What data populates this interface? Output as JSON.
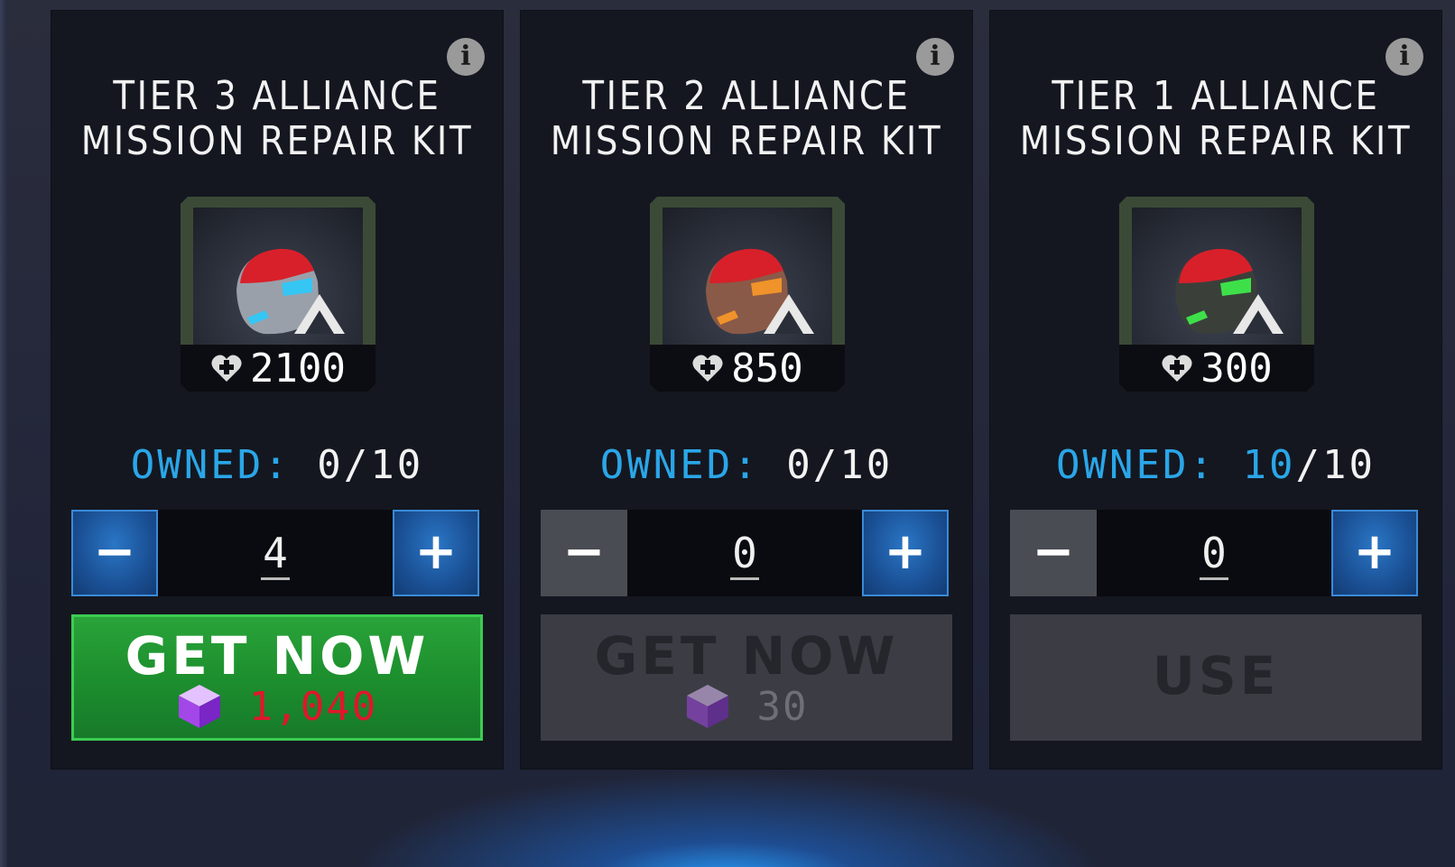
{
  "cards": [
    {
      "title_line1": "TIER 3 ALLIANCE",
      "title_line2": "MISSION REPAIR KIT",
      "heal_amount": "2100",
      "visor_color": "#35c6f4",
      "armor_color": "#9aa0aa",
      "owned_label": "OWNED:",
      "owned_count": "0",
      "owned_max": "/10",
      "quantity": "4",
      "minus_label": "−",
      "plus_label": "+",
      "action_label": "GET NOW",
      "price": "1,040",
      "icon": "info-icon"
    },
    {
      "title_line1": "TIER 2 ALLIANCE",
      "title_line2": "MISSION REPAIR KIT",
      "heal_amount": "850",
      "visor_color": "#f0932a",
      "armor_color": "#8a5a48",
      "owned_label": "OWNED:",
      "owned_count": "0",
      "owned_max": "/10",
      "quantity": "0",
      "minus_label": "−",
      "plus_label": "+",
      "action_label": "GET NOW",
      "price": "30",
      "icon": "info-icon"
    },
    {
      "title_line1": "TIER 1 ALLIANCE",
      "title_line2": "MISSION REPAIR KIT",
      "heal_amount": "300",
      "visor_color": "#3ee04a",
      "armor_color": "#3a3f3a",
      "owned_label": "OWNED:",
      "owned_count": "10",
      "owned_max": "/10",
      "quantity": "0",
      "minus_label": "−",
      "plus_label": "+",
      "action_label": "USE",
      "icon": "info-icon"
    }
  ],
  "colors": {
    "accent_blue": "#2aa6e8",
    "get_now_green": "#1d8f2e",
    "price_red": "#e0162c",
    "disabled_gray": "#3c3d44"
  }
}
